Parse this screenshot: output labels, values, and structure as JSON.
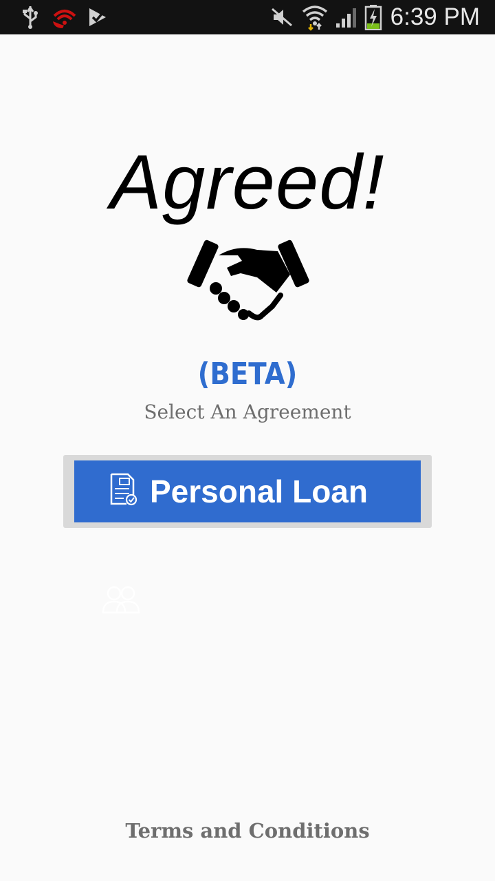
{
  "status_bar": {
    "time": "6:39 PM",
    "icons": [
      "usb-icon",
      "wifi-calling-icon",
      "download-done-icon",
      "mute-icon",
      "wifi-icon",
      "signal-icon",
      "battery-charging-icon"
    ]
  },
  "app": {
    "title": "Agreed!",
    "logo_icon": "handshake-icon",
    "beta_label": "(BETA)",
    "subtitle": "Select An Agreement"
  },
  "agreements": [
    {
      "label": "Personal Loan",
      "icon": "document-check-icon"
    }
  ],
  "extra_icon": "people-icon",
  "footer": {
    "terms_label": "Terms and Conditions"
  },
  "colors": {
    "accent": "#306ccf",
    "status_bar_bg": "#121212",
    "background": "#fafafa",
    "muted_text": "#6e6e6e"
  }
}
